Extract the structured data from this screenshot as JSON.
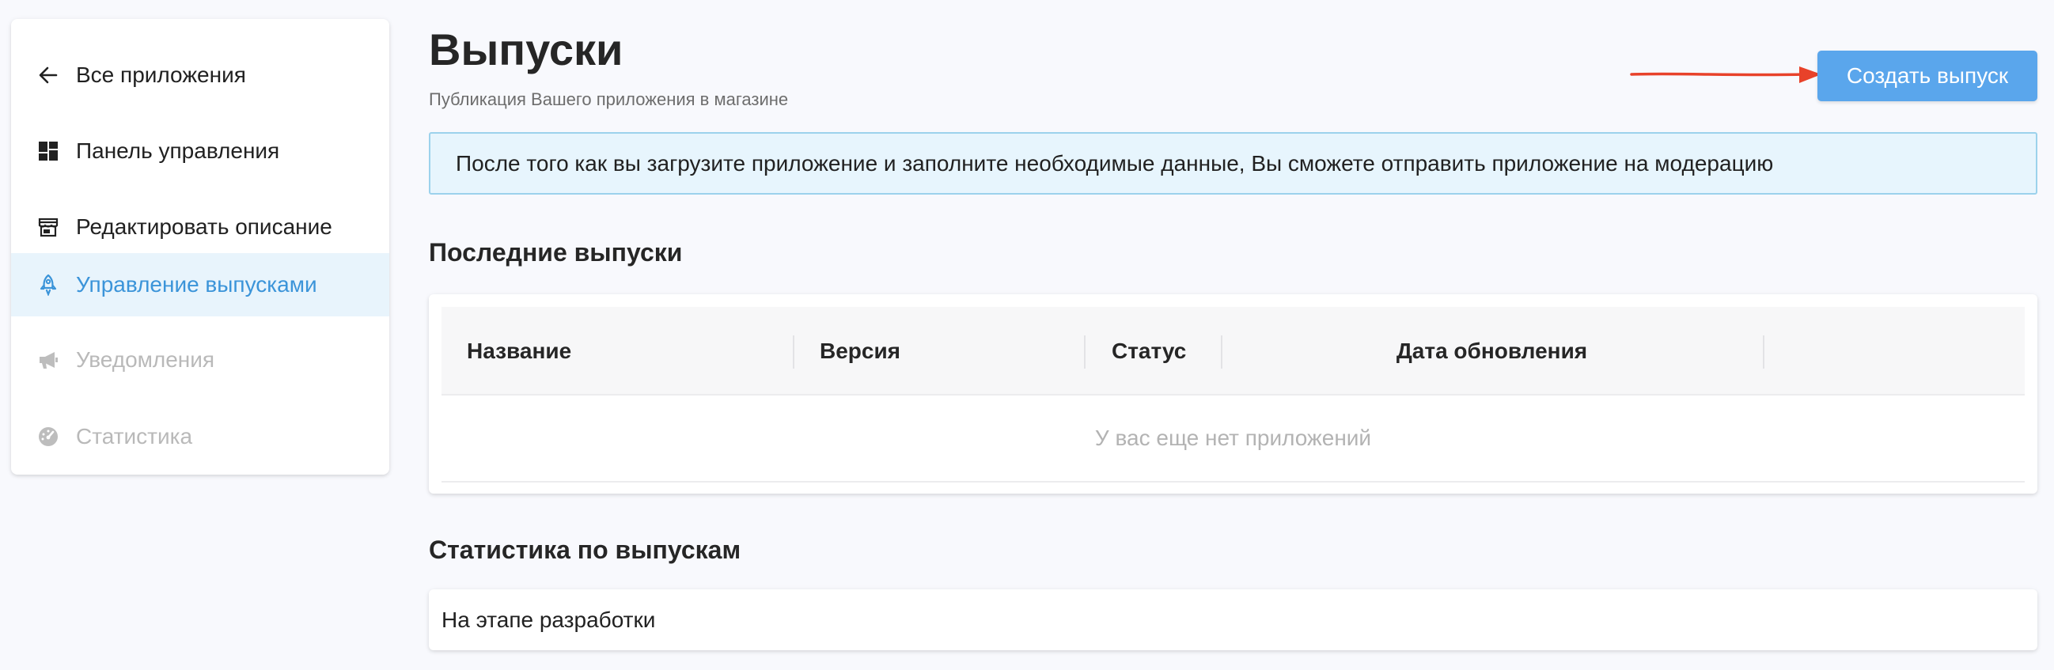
{
  "sidebar": {
    "items": [
      {
        "label": "Все приложения",
        "icon": "arrow-left-icon"
      },
      {
        "label": "Панель управления",
        "icon": "dashboard-grid-icon"
      },
      {
        "label": "Редактировать описание",
        "icon": "store-icon"
      },
      {
        "label": "Управление выпусками",
        "icon": "rocket-icon",
        "active": true
      },
      {
        "label": "Уведомления",
        "icon": "megaphone-icon",
        "disabled": true
      },
      {
        "label": "Статистика",
        "icon": "speedometer-icon",
        "disabled": true
      }
    ]
  },
  "header": {
    "title": "Выпуски",
    "subtitle": "Публикация Вашего приложения в магазине",
    "create_button_label": "Создать выпуск"
  },
  "info_banner": {
    "text": "После того как вы загрузите приложение и заполните необходимые данные, Вы сможете отправить приложение на модерацию"
  },
  "releases": {
    "title": "Последние выпуски",
    "columns": [
      "Название",
      "Версия",
      "Статус",
      "Дата обновления"
    ],
    "empty_text": "У вас еще нет приложений"
  },
  "stats": {
    "title": "Статистика по выпускам",
    "text": "На этапе разработки"
  },
  "colors": {
    "accent": "#5aa6ec",
    "active_text": "#3b94d9",
    "active_bg": "#e8f4fc",
    "annotation_arrow": "#e8422a"
  }
}
